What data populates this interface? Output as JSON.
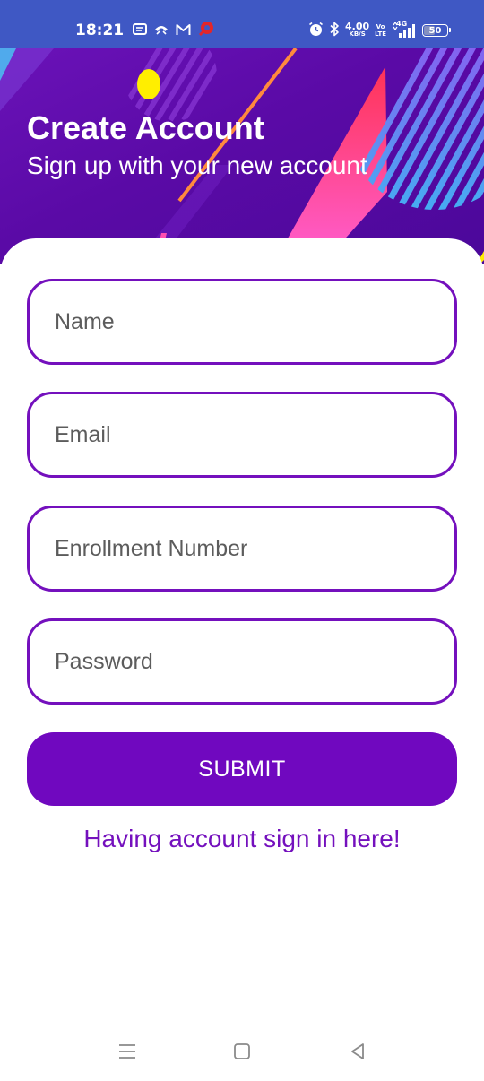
{
  "status_bar": {
    "time": "18:21",
    "notification_icons": [
      "message-icon",
      "call-icon",
      "gmail-icon",
      "app-icon"
    ],
    "net_speed_value": "4.00",
    "net_speed_unit": "KB/S",
    "volte_top": "Vo",
    "volte_bottom": "LTE",
    "network_type": "4G",
    "battery_level": "50",
    "colors": {
      "background": "#3f58c4"
    }
  },
  "header": {
    "title": "Create Account",
    "subtitle": "Sign up with your new account",
    "colors": {
      "background": "#5a0aa6",
      "accent_pink": "#ff3c8e",
      "accent_blue": "#4cc3f0",
      "accent_yellow": "#ffee00"
    }
  },
  "form": {
    "name_placeholder": "Name",
    "email_placeholder": "Email",
    "enrollment_placeholder": "Enrollment Number",
    "password_placeholder": "Password",
    "submit_label": "SUBMIT",
    "signin_link": "Having account sign in here!",
    "colors": {
      "accent": "#7410bd",
      "button": "#7008bf"
    }
  },
  "nav_bar": {
    "icons": [
      "menu-icon",
      "home-icon",
      "back-icon"
    ]
  }
}
